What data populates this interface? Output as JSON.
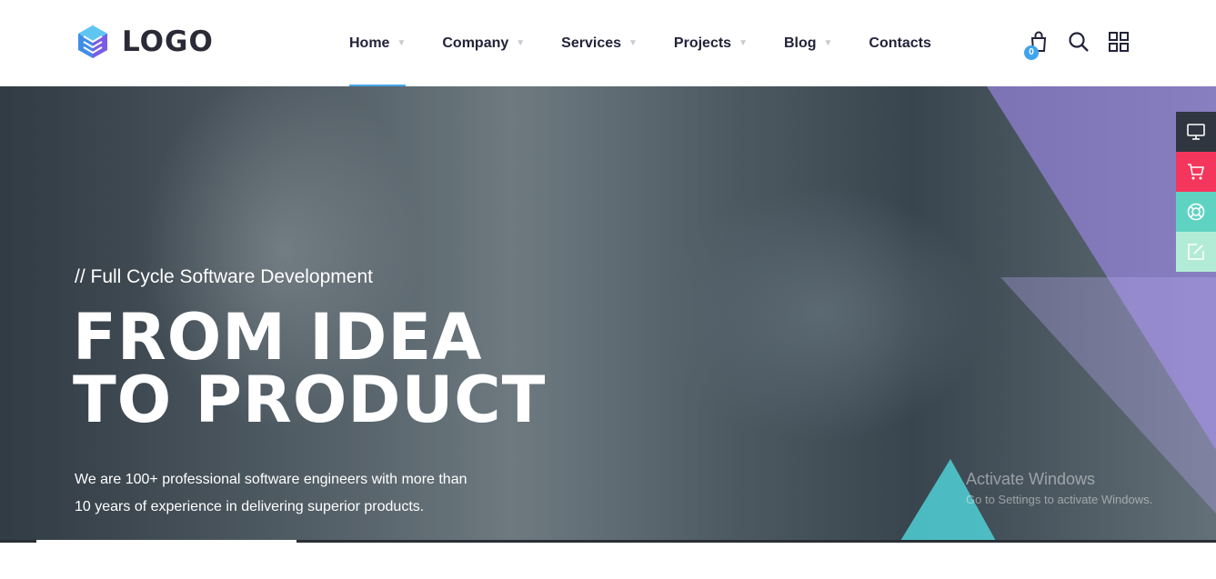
{
  "header": {
    "logo_text": "LOGO",
    "nav": [
      {
        "label": "Home",
        "caret": "▼"
      },
      {
        "label": "Company",
        "caret": "▼"
      },
      {
        "label": "Services",
        "caret": "▼"
      },
      {
        "label": "Projects",
        "caret": "▼"
      },
      {
        "label": "Blog",
        "caret": "▼"
      },
      {
        "label": "Contacts",
        "caret": ""
      }
    ],
    "cart_count": "0",
    "icons": [
      "shopping-bag-icon",
      "search-icon",
      "grid-menu-icon"
    ]
  },
  "hero": {
    "subtitle": "// Full Cycle Software Development",
    "title_line1": "FROM IDEA",
    "title_line2": "TO PRODUCT",
    "text_line1": "We are 100+ professional software engineers with more than",
    "text_line2": "10 years of experience in delivering superior products."
  },
  "watermark": {
    "line1": "Activate Windows",
    "line2": "Go to Settings to activate Windows."
  },
  "side_tools": [
    {
      "icon": "monitor-icon",
      "color": "#2f3640"
    },
    {
      "icon": "cart-icon",
      "color": "#f5365c"
    },
    {
      "icon": "lifebuoy-icon",
      "color": "#5fd3c1"
    },
    {
      "icon": "edit-icon",
      "color": "#b3ecd6"
    }
  ],
  "colors": {
    "accent": "#45a6ea",
    "hero_triangle": "#9b87e6",
    "teal_triangle": "#4fd0d6"
  }
}
